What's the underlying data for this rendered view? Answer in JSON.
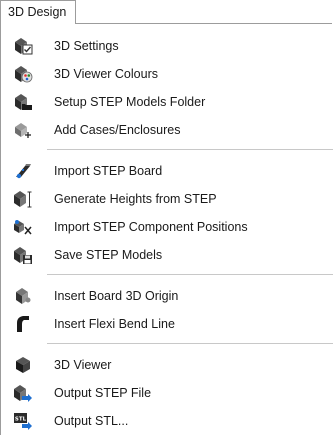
{
  "tab": {
    "label": "3D Design"
  },
  "menu": {
    "groups": [
      [
        {
          "label": "3D Settings",
          "icon": "3d-settings-icon"
        },
        {
          "label": "3D Viewer Colours",
          "icon": "viewer-colours-icon"
        },
        {
          "label": "Setup STEP Models Folder",
          "icon": "step-folder-icon"
        },
        {
          "label": "Add Cases/Enclosures",
          "icon": "add-enclosure-icon"
        }
      ],
      [
        {
          "label": "Import STEP Board",
          "icon": "import-board-icon"
        },
        {
          "label": "Generate Heights from STEP",
          "icon": "generate-heights-icon"
        },
        {
          "label": "Import STEP Component Positions",
          "icon": "import-positions-icon"
        },
        {
          "label": "Save STEP Models",
          "icon": "save-models-icon"
        }
      ],
      [
        {
          "label": "Insert Board 3D Origin",
          "icon": "board-origin-icon"
        },
        {
          "label": "Insert Flexi Bend Line",
          "icon": "flexi-bend-icon"
        }
      ],
      [
        {
          "label": "3D Viewer",
          "icon": "3d-viewer-icon"
        },
        {
          "label": "Output STEP File",
          "icon": "output-step-icon"
        },
        {
          "label": "Output STL...",
          "icon": "output-stl-icon"
        }
      ]
    ]
  },
  "colors": {
    "icon_dark": "#2b2b2b",
    "icon_grey": "#8a8a8a",
    "icon_blue": "#1e6fd0",
    "separator": "#c8c8c8"
  }
}
